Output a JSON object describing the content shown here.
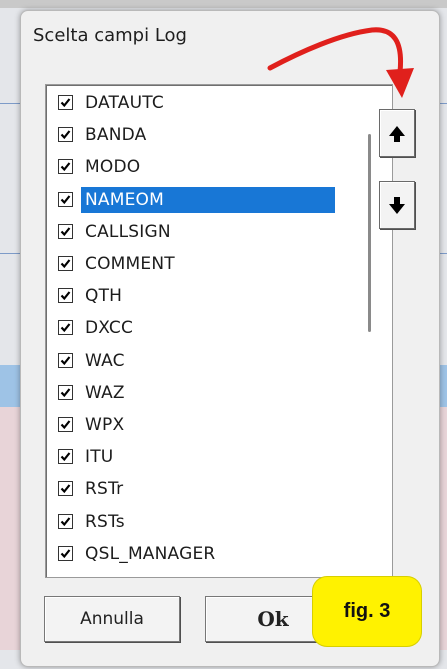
{
  "dialog": {
    "title": "Scelta campi Log"
  },
  "fields": [
    {
      "label": "DATAUTC",
      "checked": true,
      "selected": false
    },
    {
      "label": "BANDA",
      "checked": true,
      "selected": false
    },
    {
      "label": "MODO",
      "checked": true,
      "selected": false
    },
    {
      "label": "NAMEOM",
      "checked": true,
      "selected": true
    },
    {
      "label": "CALLSIGN",
      "checked": true,
      "selected": false
    },
    {
      "label": "COMMENT",
      "checked": true,
      "selected": false
    },
    {
      "label": "QTH",
      "checked": true,
      "selected": false
    },
    {
      "label": "DXCC",
      "checked": true,
      "selected": false
    },
    {
      "label": "WAC",
      "checked": true,
      "selected": false
    },
    {
      "label": "WAZ",
      "checked": true,
      "selected": false
    },
    {
      "label": "WPX",
      "checked": true,
      "selected": false
    },
    {
      "label": "ITU",
      "checked": true,
      "selected": false
    },
    {
      "label": "RSTr",
      "checked": true,
      "selected": false
    },
    {
      "label": "RSTs",
      "checked": true,
      "selected": false
    },
    {
      "label": "QSL_MANAGER",
      "checked": true,
      "selected": false
    }
  ],
  "buttons": {
    "cancel": "Annulla",
    "ok": "Ok",
    "move_up_icon": "arrow-up-icon",
    "move_down_icon": "arrow-down-icon"
  },
  "annotation": {
    "figure_label": "fig. 3",
    "arrow_color": "#e0201c"
  },
  "colors": {
    "selection": "#1877d6",
    "figure_label_bg": "#fff200"
  }
}
